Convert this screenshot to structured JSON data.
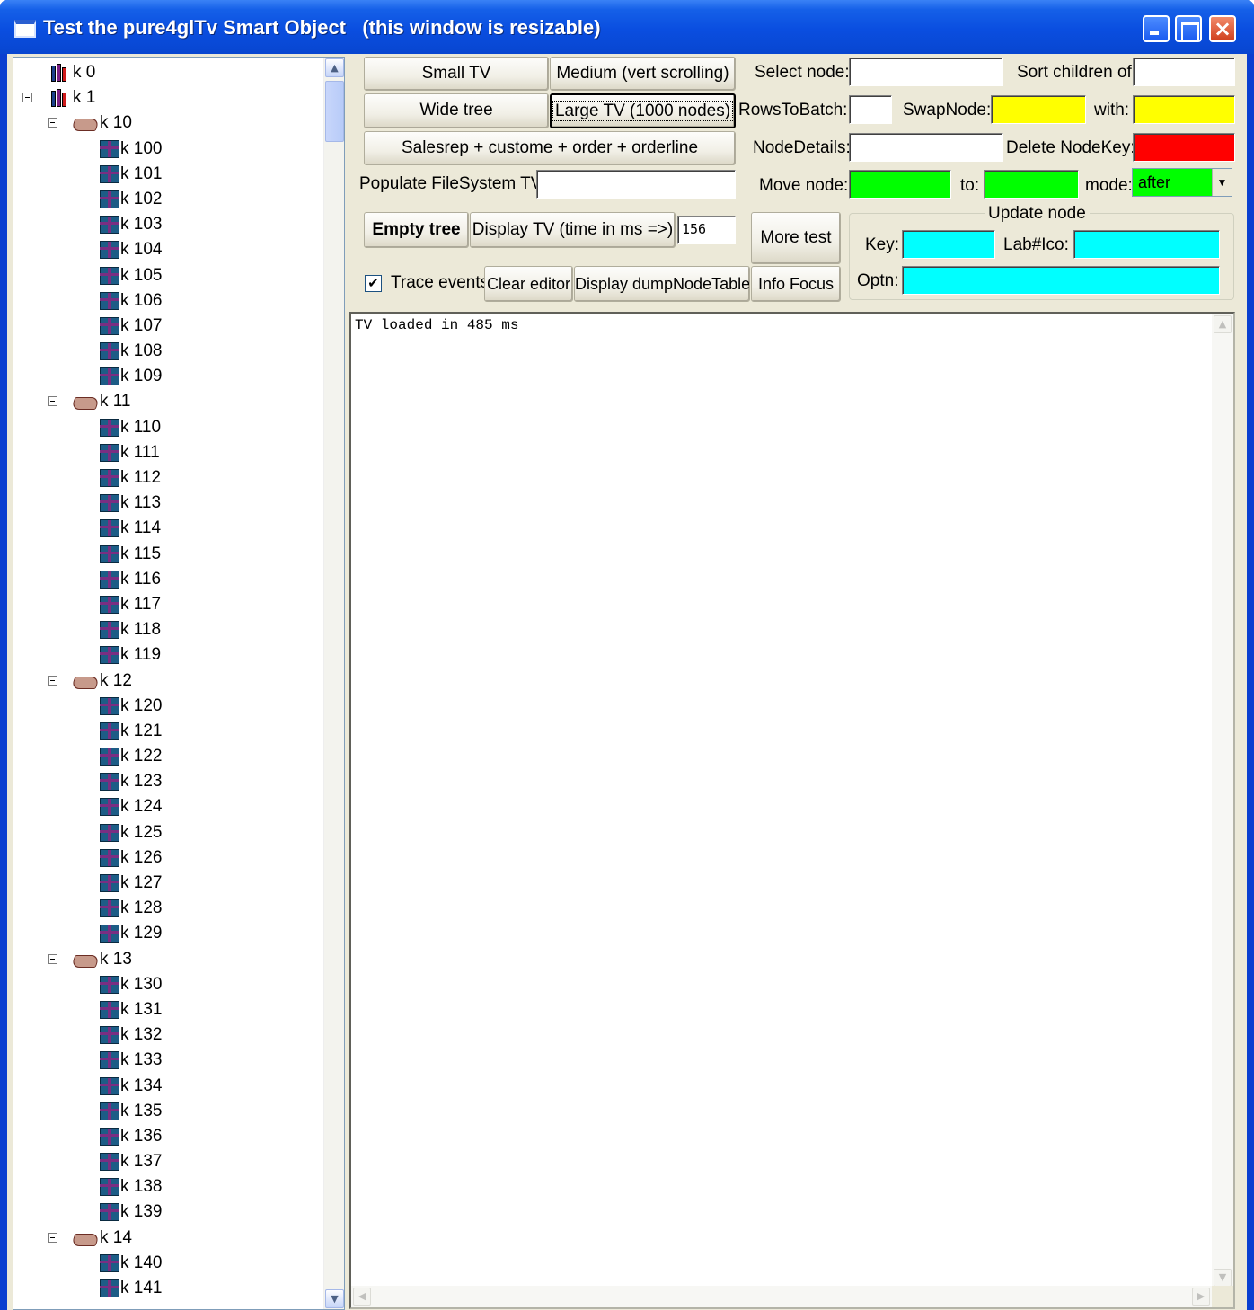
{
  "window": {
    "title": "Test the pure4glTv Smart Object   (this window is resizable)",
    "close_glyph": "×"
  },
  "tree": {
    "nodes": [
      {
        "key": "k 0",
        "level": 0,
        "icon": "books-icon",
        "expanded": false
      },
      {
        "key": "k 1",
        "level": 0,
        "icon": "books-icon",
        "expanded": true
      },
      {
        "key": "k 10",
        "level": 1,
        "icon": "open-book-icon",
        "expanded": true
      },
      {
        "key": "k 100",
        "level": 2,
        "icon": "gift-icon"
      },
      {
        "key": "k 101",
        "level": 2,
        "icon": "gift-icon"
      },
      {
        "key": "k 102",
        "level": 2,
        "icon": "gift-icon"
      },
      {
        "key": "k 103",
        "level": 2,
        "icon": "gift-icon"
      },
      {
        "key": "k 104",
        "level": 2,
        "icon": "gift-icon"
      },
      {
        "key": "k 105",
        "level": 2,
        "icon": "gift-icon"
      },
      {
        "key": "k 106",
        "level": 2,
        "icon": "gift-icon"
      },
      {
        "key": "k 107",
        "level": 2,
        "icon": "gift-icon"
      },
      {
        "key": "k 108",
        "level": 2,
        "icon": "gift-icon"
      },
      {
        "key": "k 109",
        "level": 2,
        "icon": "gift-icon"
      },
      {
        "key": "k 11",
        "level": 1,
        "icon": "open-book-icon",
        "expanded": true
      },
      {
        "key": "k 110",
        "level": 2,
        "icon": "gift-icon"
      },
      {
        "key": "k 111",
        "level": 2,
        "icon": "gift-icon"
      },
      {
        "key": "k 112",
        "level": 2,
        "icon": "gift-icon"
      },
      {
        "key": "k 113",
        "level": 2,
        "icon": "gift-icon"
      },
      {
        "key": "k 114",
        "level": 2,
        "icon": "gift-icon"
      },
      {
        "key": "k 115",
        "level": 2,
        "icon": "gift-icon"
      },
      {
        "key": "k 116",
        "level": 2,
        "icon": "gift-icon"
      },
      {
        "key": "k 117",
        "level": 2,
        "icon": "gift-icon"
      },
      {
        "key": "k 118",
        "level": 2,
        "icon": "gift-icon"
      },
      {
        "key": "k 119",
        "level": 2,
        "icon": "gift-icon"
      },
      {
        "key": "k 12",
        "level": 1,
        "icon": "open-book-icon",
        "expanded": true
      },
      {
        "key": "k 120",
        "level": 2,
        "icon": "gift-icon"
      },
      {
        "key": "k 121",
        "level": 2,
        "icon": "gift-icon"
      },
      {
        "key": "k 122",
        "level": 2,
        "icon": "gift-icon"
      },
      {
        "key": "k 123",
        "level": 2,
        "icon": "gift-icon"
      },
      {
        "key": "k 124",
        "level": 2,
        "icon": "gift-icon"
      },
      {
        "key": "k 125",
        "level": 2,
        "icon": "gift-icon"
      },
      {
        "key": "k 126",
        "level": 2,
        "icon": "gift-icon"
      },
      {
        "key": "k 127",
        "level": 2,
        "icon": "gift-icon"
      },
      {
        "key": "k 128",
        "level": 2,
        "icon": "gift-icon"
      },
      {
        "key": "k 129",
        "level": 2,
        "icon": "gift-icon"
      },
      {
        "key": "k 13",
        "level": 1,
        "icon": "open-book-icon",
        "expanded": true
      },
      {
        "key": "k 130",
        "level": 2,
        "icon": "gift-icon"
      },
      {
        "key": "k 131",
        "level": 2,
        "icon": "gift-icon"
      },
      {
        "key": "k 132",
        "level": 2,
        "icon": "gift-icon"
      },
      {
        "key": "k 133",
        "level": 2,
        "icon": "gift-icon"
      },
      {
        "key": "k 134",
        "level": 2,
        "icon": "gift-icon"
      },
      {
        "key": "k 135",
        "level": 2,
        "icon": "gift-icon"
      },
      {
        "key": "k 136",
        "level": 2,
        "icon": "gift-icon"
      },
      {
        "key": "k 137",
        "level": 2,
        "icon": "gift-icon"
      },
      {
        "key": "k 138",
        "level": 2,
        "icon": "gift-icon"
      },
      {
        "key": "k 139",
        "level": 2,
        "icon": "gift-icon"
      },
      {
        "key": "k 14",
        "level": 1,
        "icon": "open-book-icon",
        "expanded": true
      },
      {
        "key": "k 140",
        "level": 2,
        "icon": "gift-icon"
      },
      {
        "key": "k 141",
        "level": 2,
        "icon": "gift-icon"
      }
    ],
    "scroll_up_glyph": "▲",
    "scroll_down_glyph": "▼"
  },
  "buttons": {
    "small_tv": "Small TV",
    "medium": "Medium (vert scrolling)",
    "wide_tree": "Wide tree",
    "large_tv": "Large TV (1000 nodes)",
    "salesrep": "Salesrep + custome + order + orderline",
    "empty_tree": "Empty tree",
    "display_tv": "Display TV  (time in ms =>)",
    "more_test": "More test",
    "clear_editor": "Clear editor",
    "display_dump": "Display dumpNodeTable",
    "info_focus": "Info Focus"
  },
  "fields": {
    "populate_fs_label": "Populate FileSystem TV:",
    "populate_fs_value": "",
    "select_node_label": "Select node:",
    "select_node_value": "",
    "sort_children_label": "Sort children of:",
    "sort_children_value": "",
    "rows_to_batch_label": "RowsToBatch:",
    "rows_to_batch_value": "",
    "swap_node_label": "SwapNode:",
    "swap_node_value": "",
    "with_label": "with:",
    "with_value": "",
    "node_details_label": "NodeDetails:",
    "node_details_value": "",
    "delete_nodekey_label": "Delete NodeKey:",
    "delete_nodekey_value": "",
    "move_node_label": "Move node:",
    "move_node_value": "",
    "to_label": "to:",
    "to_value": "",
    "mode_label": "mode:",
    "mode_value": "after",
    "mode_arrow": "▼",
    "display_time_value": "156",
    "trace_events_label": "Trace events",
    "trace_events_checked": "✔"
  },
  "update_node": {
    "title": "Update node",
    "key_label": "Key:",
    "key_value": "",
    "labico_label": "Lab#Ico:",
    "labico_value": "",
    "optn_label": "Optn:",
    "optn_value": ""
  },
  "editor": {
    "text": "TV loaded in 485 ms",
    "scroll_up_glyph": "▲",
    "scroll_down_glyph": "▼",
    "scroll_left_glyph": "◀",
    "scroll_right_glyph": "▶"
  },
  "colors": {
    "yellow": "#ffff00",
    "red": "#ff0000",
    "green": "#00ff00",
    "cyan": "#00ffff"
  }
}
